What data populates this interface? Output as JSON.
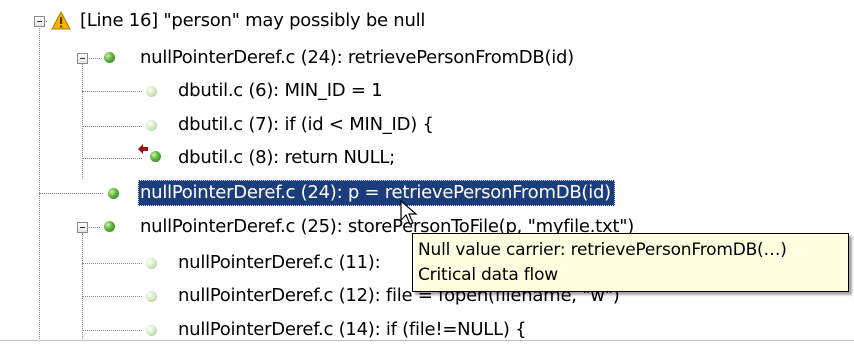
{
  "tree": {
    "rows": [
      {
        "label": "[Line 16] \"person\" may possibly be null",
        "icon": "warning-icon"
      },
      {
        "label": "nullPointerDeref.c (24): retrievePersonFromDB(id)",
        "icon": "green-dot-icon"
      },
      {
        "label": "dbutil.c (6): MIN_ID = 1",
        "icon": "pale-green-dot-icon"
      },
      {
        "label": "dbutil.c (7): if (id < MIN_ID) {",
        "icon": "pale-green-dot-icon"
      },
      {
        "label": "dbutil.c (8): return NULL;",
        "icon": "return-arrow-dot-icon"
      },
      {
        "label": "nullPointerDeref.c (24): p = retrievePersonFromDB(id)",
        "icon": "green-dot-icon",
        "selected": true
      },
      {
        "label": "nullPointerDeref.c (25): storePersonToFile(p, \"myfile.txt\")",
        "icon": "green-dot-icon"
      },
      {
        "label": "nullPointerDeref.c (11):",
        "icon": "pale-green-dot-icon"
      },
      {
        "label": "nullPointerDeref.c (12): file = fopen(filename, \"w\")",
        "icon": "pale-green-dot-icon"
      },
      {
        "label": "nullPointerDeref.c (14): if (file!=NULL) {",
        "icon": "pale-green-dot-icon"
      }
    ]
  },
  "tooltip": {
    "line1": "Null value carrier: retrievePersonFromDB(…)",
    "line2": "Critical data flow"
  },
  "colors": {
    "selection": "#1c3d7c",
    "tooltip_bg": "#ffffe1",
    "dot_strong": "#3f9a2c",
    "dot_pale": "#c4e2b4",
    "warning": "#f5b400",
    "return_arrow": "#9a1010"
  }
}
